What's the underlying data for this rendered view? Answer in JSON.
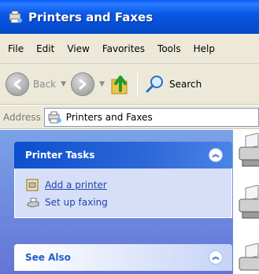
{
  "window": {
    "title": "Printers and Faxes"
  },
  "menu": [
    "File",
    "Edit",
    "View",
    "Favorites",
    "Tools",
    "Help"
  ],
  "toolbar": {
    "back_label": "Back",
    "search_label": "Search"
  },
  "address": {
    "label": "Address",
    "value": "Printers and Faxes"
  },
  "tasks": {
    "title": "Printer Tasks",
    "items": [
      {
        "label": "Add a printer",
        "icon": "add-printer-icon"
      },
      {
        "label": "Set up faxing",
        "icon": "fax-icon"
      }
    ]
  },
  "see_also": {
    "title": "See Also"
  },
  "colors": {
    "titlebar": "#0a58e8",
    "pane": "#7ba2e7",
    "panel_body": "#d6dff7",
    "link": "#2146a8"
  }
}
